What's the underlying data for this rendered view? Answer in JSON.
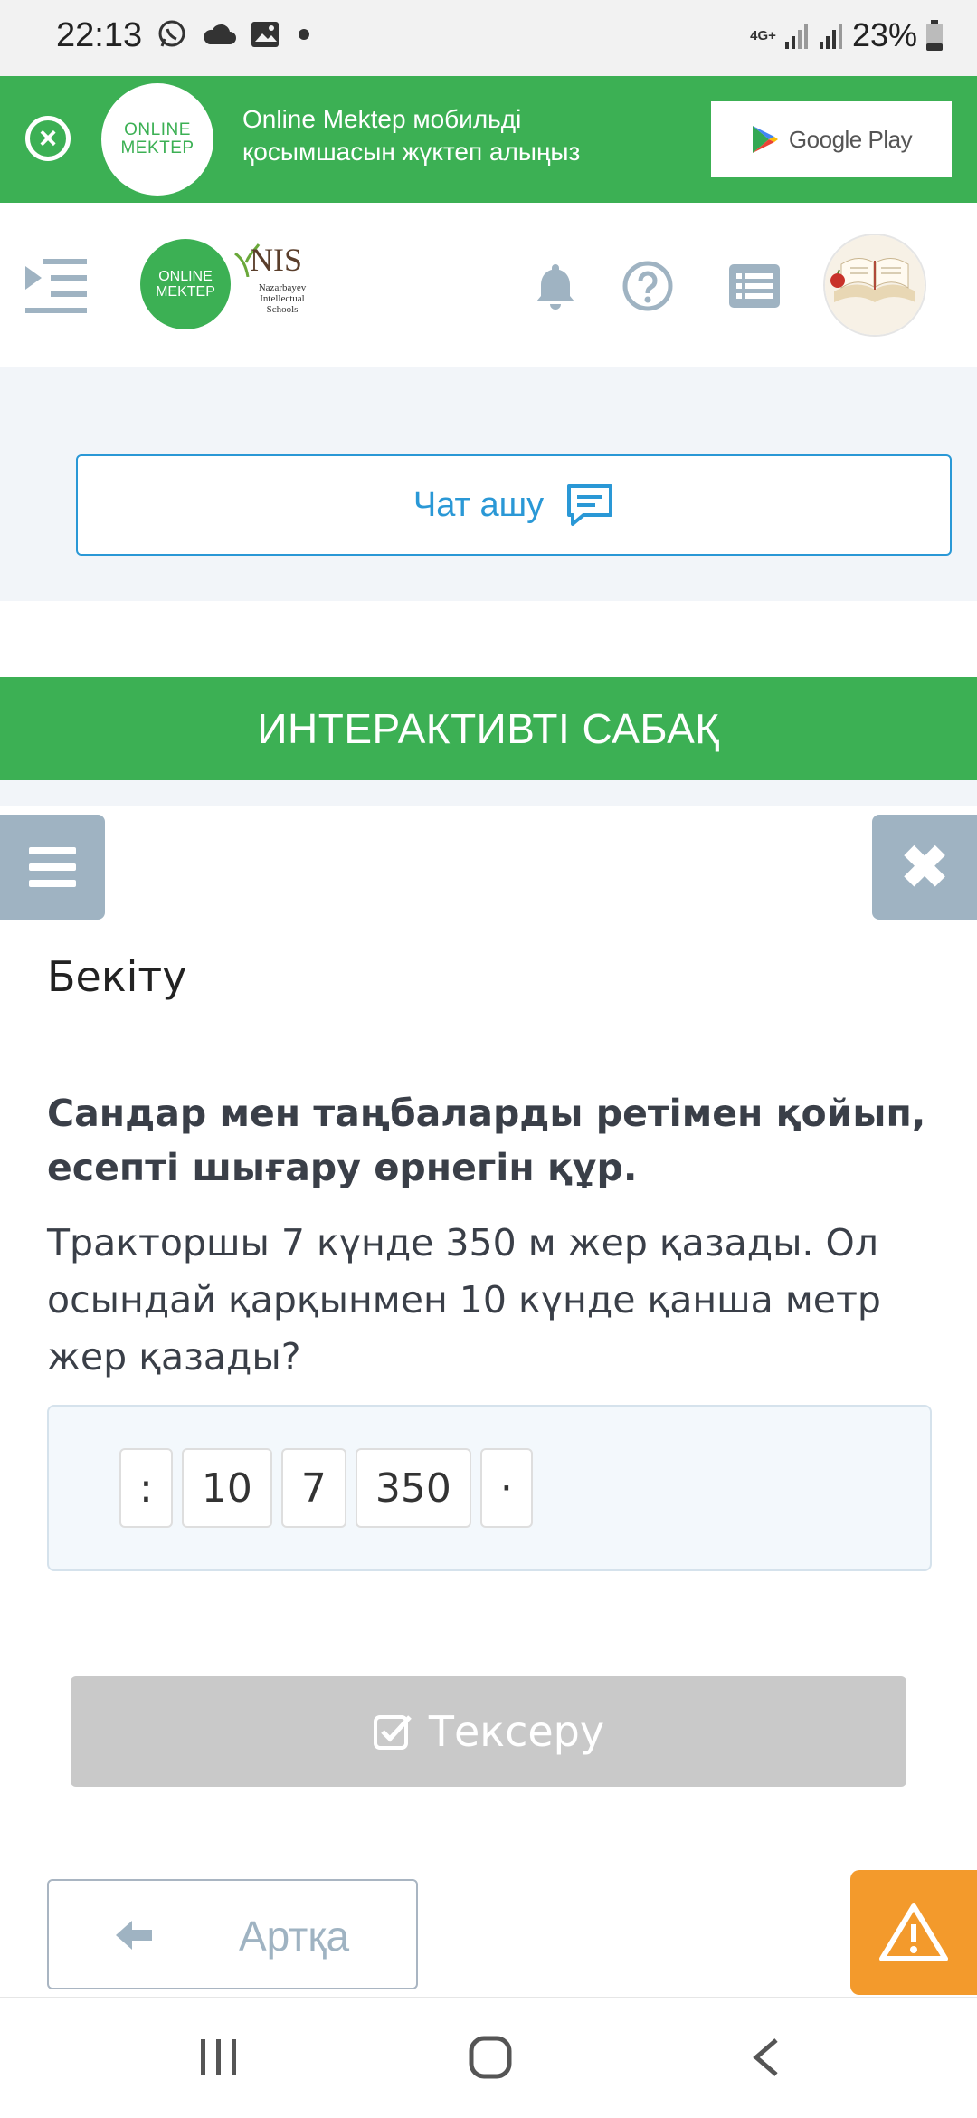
{
  "status_bar": {
    "time": "22:13",
    "network": "4G+",
    "battery": "23%",
    "icons": [
      "whatsapp-icon",
      "cloud-icon",
      "gallery-icon",
      "dot-icon",
      "signal-icon",
      "battery-icon"
    ]
  },
  "promo": {
    "logo_line1": "ONLINE",
    "logo_line2": "MEKTEP",
    "text": "Online Mektep мобильді қосымшасын жүктеп алыңыз",
    "store_label": "Google Play"
  },
  "header": {
    "logo_line1": "ONLINE",
    "logo_line2": "MEKTEP",
    "nis_title": "NIS",
    "nis_sub": "Nazarbayev Intellectual Schools",
    "icons": [
      "menu-toggle-icon",
      "bell-icon",
      "help-icon",
      "list-icon",
      "avatar"
    ]
  },
  "chat": {
    "label": "Чат ашу"
  },
  "interactive": {
    "label": "ИНТЕРАКТИВТІ САБАҚ"
  },
  "lesson": {
    "section_title": "Бекіту",
    "task_title": "Сандар мен таңбаларды ретімен қойып, есепті шығару өрнегін құр.",
    "task_text": "Тракторшы 7 күнде 350 м жер қазады. Ол осындай қарқынмен 10 күнде қанша метр жер қазады?",
    "tokens": [
      ":",
      "10",
      "7",
      "350",
      "·"
    ],
    "check_label": "Тексеру",
    "back_label": "Артқа"
  },
  "colors": {
    "brand_green": "#3cb054",
    "link_blue": "#2a98d6",
    "muted_gray_blue": "#9fb3c2",
    "warning_orange": "#f39a2c",
    "disabled_gray": "#c9c9c9"
  }
}
